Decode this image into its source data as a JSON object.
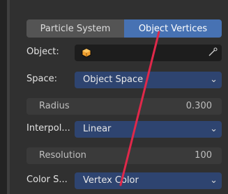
{
  "emit_from": {
    "tabs": [
      {
        "label": "Particle System",
        "active": false
      },
      {
        "label": "Object Vertices",
        "active": true
      }
    ]
  },
  "fields": {
    "object": {
      "label": "Object:",
      "value": "",
      "icon": "object-icon",
      "picker_icon": "eyedropper-icon"
    },
    "space": {
      "label": "Space:",
      "value": "Object Space"
    },
    "radius": {
      "label": "Radius",
      "value": "0.300"
    },
    "interpolation": {
      "label": "Interpol...",
      "value": "Linear"
    },
    "resolution": {
      "label": "Resolution",
      "value": "100"
    },
    "color_source": {
      "label": "Color S...",
      "value": "Vertex Color"
    }
  },
  "colors": {
    "active_tab": "#4772b3",
    "enum_field": "#2e4470",
    "annotation_line": "#e0284a"
  }
}
